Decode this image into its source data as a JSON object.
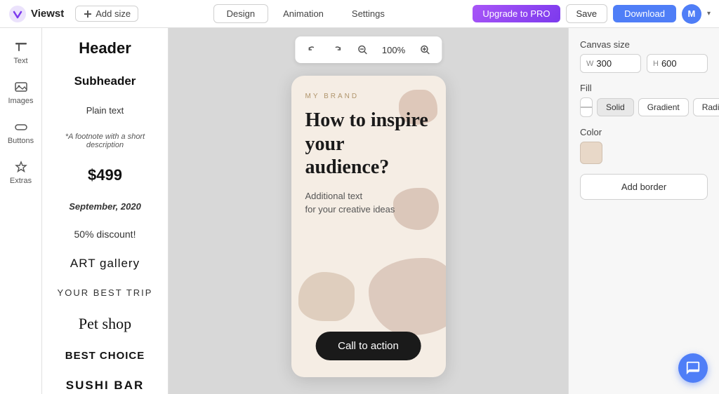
{
  "topbar": {
    "logo_text": "Viewst",
    "add_size_label": "Add size",
    "tabs": [
      {
        "label": "Design",
        "active": true
      },
      {
        "label": "Animation",
        "active": false
      },
      {
        "label": "Settings",
        "active": false
      }
    ],
    "upgrade_label": "Upgrade to PRO",
    "save_label": "Save",
    "download_label": "Download",
    "avatar_letter": "M"
  },
  "icon_sidebar": {
    "items": [
      {
        "label": "Text",
        "icon": "text-icon"
      },
      {
        "label": "Images",
        "icon": "images-icon"
      },
      {
        "label": "Buttons",
        "icon": "buttons-icon"
      },
      {
        "label": "Extras",
        "icon": "extras-icon"
      }
    ]
  },
  "text_panel": {
    "items": [
      {
        "type": "header",
        "text": "Header"
      },
      {
        "type": "subheader",
        "text": "Subheader"
      },
      {
        "type": "plain",
        "text": "Plain text"
      },
      {
        "type": "footnote",
        "text": "*A footnote with a short description"
      },
      {
        "type": "price",
        "text": "$499"
      },
      {
        "type": "date",
        "text": "September, 2020"
      },
      {
        "type": "discount",
        "text": "50% discount!"
      },
      {
        "type": "art",
        "text": "ART gallery"
      },
      {
        "type": "trip",
        "text": "YOUR BEST TRIP"
      },
      {
        "type": "petshop",
        "text": "Pet shop"
      },
      {
        "type": "bestchoice",
        "text": "BEST CHOICE"
      },
      {
        "type": "sushibar",
        "text": "SUSHI BAR"
      }
    ]
  },
  "canvas": {
    "zoom": "100%",
    "card": {
      "brand": "MY BRAND",
      "headline": "How to inspire your audience?",
      "subtext": "Additional text\nfor your creative ideas",
      "cta_label": "Call to action"
    }
  },
  "right_panel": {
    "canvas_size_label": "Canvas size",
    "width_label": "W",
    "width_value": "300",
    "height_label": "H",
    "height_value": "600",
    "fill_label": "Fill",
    "fill_options": [
      {
        "label": "—",
        "type": "none"
      },
      {
        "label": "Solid",
        "active": true
      },
      {
        "label": "Gradient",
        "active": false
      },
      {
        "label": "Radial",
        "active": false
      }
    ],
    "color_label": "Color",
    "add_border_label": "Add border"
  }
}
